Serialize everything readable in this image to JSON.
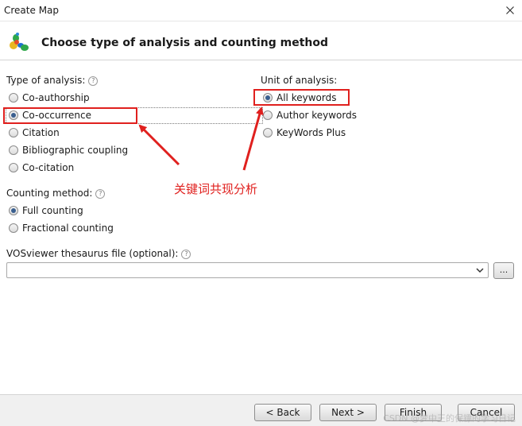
{
  "window": {
    "title": "Create Map"
  },
  "header": {
    "title": "Choose type of analysis and counting method",
    "logo_icon": "vosviewer-logo-icon"
  },
  "analysis_type": {
    "label": "Type of analysis:",
    "options": [
      "Co-authorship",
      "Co-occurrence",
      "Citation",
      "Bibliographic coupling",
      "Co-citation"
    ],
    "selected": "Co-occurrence"
  },
  "unit_of_analysis": {
    "label": "Unit of analysis:",
    "options": [
      "All keywords",
      "Author keywords",
      "KeyWords Plus"
    ],
    "selected": "All keywords"
  },
  "counting_method": {
    "label": "Counting method:",
    "options": [
      "Full counting",
      "Fractional counting"
    ],
    "selected": "Full counting"
  },
  "thesaurus": {
    "label": "VOSviewer thesaurus file (optional):",
    "value": "",
    "browse_label": "..."
  },
  "annotation": {
    "text": "关键词共现分析",
    "color": "#e0201e"
  },
  "footer": {
    "back_label": "< Back",
    "next_label": "Next >",
    "finish_label": "Finish",
    "cancel_label": "Cancel"
  },
  "watermark": "CSDN @梦中王的保镖的学习日记",
  "colors": {
    "accent": "#3a5f8f",
    "annotation_red": "#e0201e"
  }
}
